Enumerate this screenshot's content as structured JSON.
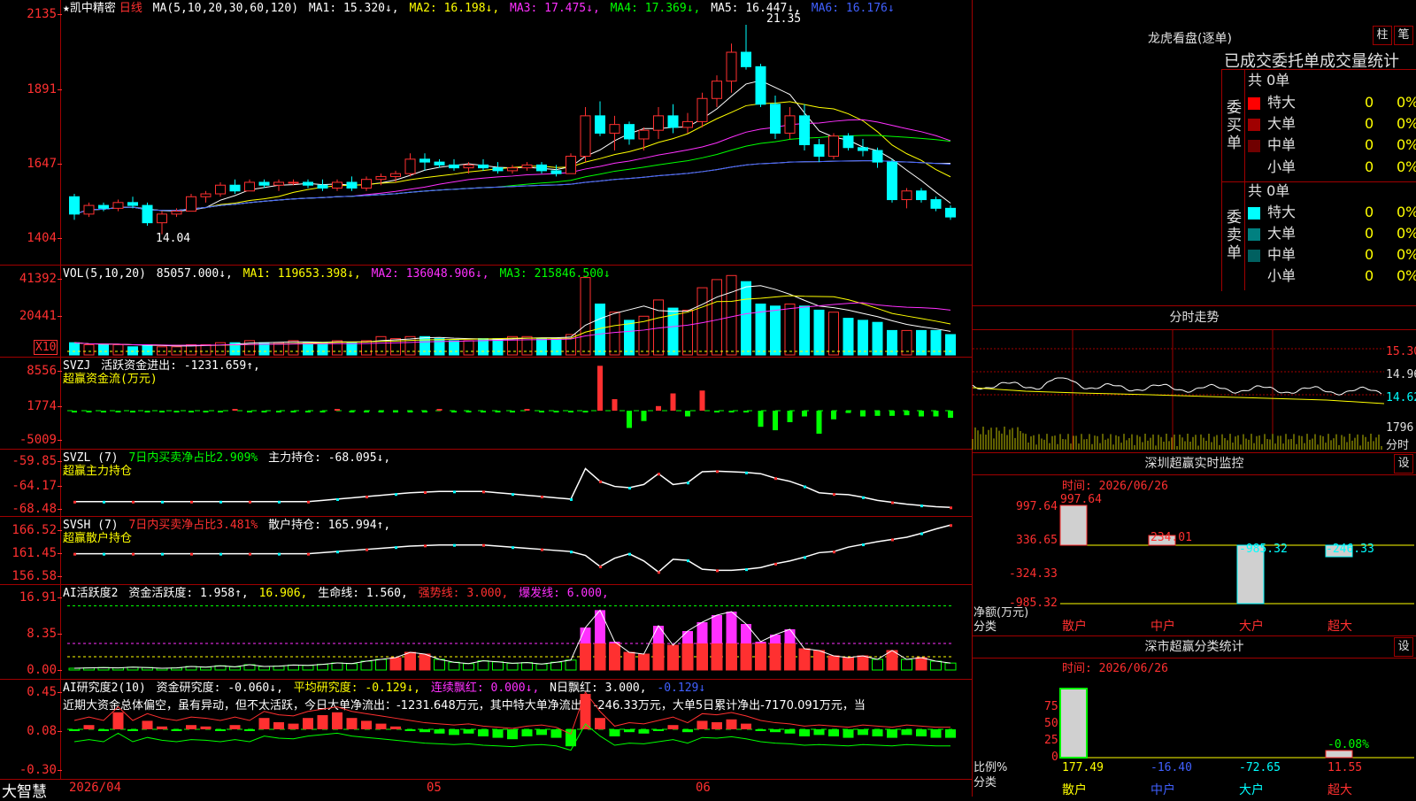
{
  "colors": {
    "up": "#ff3030",
    "down": "#00ffff",
    "bg": "#000000",
    "grid": "#a00000"
  },
  "kline": {
    "title": "★凯中精密",
    "period": "日线",
    "ma_label": "MA(5,10,20,30,60,120)",
    "ma1": "MA1: 15.320↓,",
    "ma2": "MA2: 16.198↓,",
    "ma3": "MA3: 17.475↓,",
    "ma4": "MA4: 17.369↓,",
    "ma5": "MA5: 16.447↓,",
    "ma6": "MA6: 16.176↓",
    "yticks": [
      "2135",
      "1891",
      "1647",
      "1404"
    ],
    "high_label": "21.35",
    "low_label": "14.04"
  },
  "volume": {
    "label": "VOL(5,10,20)",
    "val": "85057.000↓,",
    "ma1": "MA1: 119653.398↓,",
    "ma2": "MA2: 136048.906↓,",
    "ma3": "MA3: 215846.500↓",
    "yticks": [
      "41392",
      "20441"
    ],
    "unit": "X10"
  },
  "svzj": {
    "label": "SVZJ",
    "desc": "活跃资金进出: -1231.659↑,",
    "sub": "超赢资金流(万元)",
    "yticks": [
      "8556",
      "1774",
      "-5009"
    ]
  },
  "svzl": {
    "label": "SVZL (7)",
    "desc1": "7日内买卖净占比2.909%",
    "desc2": "主力持仓: -68.095↓,",
    "sub": "超赢主力持仓",
    "yticks": [
      "-59.85",
      "-64.17",
      "-68.48"
    ]
  },
  "svsh": {
    "label": "SVSH (7)",
    "desc1": "7日内买卖净占比3.481%",
    "desc2": "散户持仓: 165.994↑,",
    "sub": "超赢散户持仓",
    "yticks": [
      "166.52",
      "161.45",
      "156.58"
    ]
  },
  "ai1": {
    "label": "AI活跃度2",
    "d1": "资金活跃度: 1.958↑,",
    "d2": "16.906,",
    "d3": "生命线: 1.560,",
    "d4": "强势线: 3.000,",
    "d5": "爆发线: 6.000,",
    "yticks": [
      "16.91",
      "8.35",
      "0.00"
    ]
  },
  "ai2": {
    "label": "AI研究度2(10)",
    "d1": "资金研究度: -0.060↓,",
    "d2": "平均研究度: -0.129↓,",
    "d3": "连续飘红: 0.000↓,",
    "d4": "N日飘红: 3.000,",
    "d5": "-0.129↓",
    "note": "近期大资金总体偏空，虽有异动，但不太活跃，今日大单净流出：-1231.648万元，其中特大单净流出：-246.33万元，大单5日累计净出-7170.091万元，当",
    "yticks": [
      "0.45",
      "0.08",
      "-0.30"
    ]
  },
  "footer": {
    "brand": "大智慧",
    "d1": "2026/04",
    "d2": "05",
    "d3": "06"
  },
  "dragon": {
    "title": "龙虎看盘(逐单)",
    "btn1": "柱",
    "btn2": "笔",
    "header": "已成交委托单成交量统计",
    "buy_side": "委买单",
    "sell_side": "委卖单",
    "buy_total": "共 0单",
    "sell_total": "共 0单",
    "buy_rows": [
      {
        "name": "特大",
        "v": "0",
        "p": "0%"
      },
      {
        "name": "大单",
        "v": "0",
        "p": "0%"
      },
      {
        "name": "中单",
        "v": "0",
        "p": "0%"
      },
      {
        "name": "小单",
        "v": "0",
        "p": "0%"
      }
    ],
    "sell_rows": [
      {
        "name": "特大",
        "v": "0",
        "p": "0%"
      },
      {
        "name": "大单",
        "v": "0",
        "p": "0%"
      },
      {
        "name": "中单",
        "v": "0",
        "p": "0%"
      },
      {
        "name": "小单",
        "v": "0",
        "p": "0%"
      }
    ]
  },
  "intraday": {
    "title": "分时走势",
    "p1": "15.30",
    "p2": "14.96",
    "p3": "14.62",
    "vol": "1796",
    "unit": "分时"
  },
  "monitor": {
    "title": "深圳超赢实时监控",
    "btn": "设",
    "time": "时间: 2026/06/26",
    "yticks": [
      "997.64",
      "336.65",
      "-324.33",
      "-985.32"
    ],
    "ylabel": "净额(万元)",
    "xlabel": "分类",
    "cats": [
      "散户",
      "中户",
      "大户",
      "超大"
    ],
    "vals": [
      "997.64",
      "234.01",
      "-985.32",
      "-246.33"
    ]
  },
  "classify": {
    "title": "深市超赢分类统计",
    "btn": "设",
    "time": "时间: 2026/06/26",
    "yticks": [
      "75",
      "50",
      "25",
      "0"
    ],
    "ylabel": "比例%",
    "xlabel": "分类",
    "cats": [
      "散户",
      "中户",
      "大户",
      "超大"
    ],
    "vals": [
      "177.49",
      "-16.40",
      "-72.65",
      "11.55"
    ],
    "extra": "-0.08%"
  },
  "chart_data": [
    {
      "type": "candlestick",
      "title": "凯中精密 日线",
      "ohlc": [
        [
          15.4,
          15.5,
          14.6,
          14.8
        ],
        [
          14.8,
          15.2,
          14.7,
          15.1
        ],
        [
          15.1,
          15.2,
          14.9,
          15.0
        ],
        [
          15.0,
          15.3,
          14.9,
          15.2
        ],
        [
          15.2,
          15.4,
          15.0,
          15.1
        ],
        [
          15.1,
          15.2,
          14.4,
          14.5
        ],
        [
          14.5,
          14.9,
          14.1,
          14.8
        ],
        [
          14.8,
          15.0,
          14.7,
          14.9
        ],
        [
          14.9,
          15.5,
          14.9,
          15.4
        ],
        [
          15.4,
          15.6,
          15.2,
          15.5
        ],
        [
          15.5,
          15.9,
          15.4,
          15.8
        ],
        [
          15.8,
          16.0,
          15.5,
          15.6
        ],
        [
          15.6,
          16.0,
          15.6,
          15.9
        ],
        [
          15.9,
          16.0,
          15.7,
          15.8
        ],
        [
          15.8,
          16.0,
          15.6,
          15.9
        ],
        [
          15.9,
          16.0,
          15.8,
          15.9
        ],
        [
          15.9,
          16.0,
          15.7,
          15.8
        ],
        [
          15.8,
          16.0,
          15.6,
          15.7
        ],
        [
          15.7,
          16.0,
          15.6,
          15.9
        ],
        [
          15.9,
          16.1,
          15.6,
          15.7
        ],
        [
          15.7,
          16.1,
          15.6,
          16.0
        ],
        [
          16.0,
          16.2,
          15.8,
          16.1
        ],
        [
          16.1,
          16.3,
          15.9,
          16.2
        ],
        [
          16.2,
          16.9,
          16.1,
          16.7
        ],
        [
          16.7,
          16.9,
          16.3,
          16.6
        ],
        [
          16.6,
          16.7,
          16.4,
          16.5
        ],
        [
          16.5,
          16.7,
          16.3,
          16.4
        ],
        [
          16.4,
          16.6,
          16.2,
          16.5
        ],
        [
          16.5,
          16.7,
          16.3,
          16.4
        ],
        [
          16.4,
          16.6,
          16.2,
          16.3
        ],
        [
          16.3,
          16.5,
          16.2,
          16.4
        ],
        [
          16.4,
          16.6,
          16.3,
          16.5
        ],
        [
          16.5,
          16.6,
          16.2,
          16.3
        ],
        [
          16.3,
          16.5,
          16.1,
          16.2
        ],
        [
          16.2,
          16.9,
          16.2,
          16.8
        ],
        [
          16.8,
          18.5,
          16.6,
          18.2
        ],
        [
          18.2,
          18.7,
          17.5,
          17.6
        ],
        [
          17.6,
          18.2,
          17.0,
          17.9
        ],
        [
          17.9,
          18.0,
          17.2,
          17.4
        ],
        [
          17.4,
          17.8,
          17.0,
          17.7
        ],
        [
          17.7,
          18.5,
          17.4,
          18.2
        ],
        [
          18.2,
          18.6,
          17.6,
          17.8
        ],
        [
          17.8,
          18.3,
          17.6,
          18.0
        ],
        [
          18.0,
          19.0,
          17.8,
          18.8
        ],
        [
          18.8,
          19.6,
          18.5,
          19.4
        ],
        [
          19.4,
          20.7,
          19.0,
          20.4
        ],
        [
          20.4,
          21.35,
          19.8,
          19.9
        ],
        [
          19.9,
          20.0,
          18.5,
          18.6
        ],
        [
          18.6,
          18.9,
          17.4,
          17.6
        ],
        [
          17.6,
          18.5,
          17.4,
          18.2
        ],
        [
          18.2,
          18.6,
          17.0,
          17.2
        ],
        [
          17.2,
          17.4,
          16.6,
          16.8
        ],
        [
          16.8,
          17.6,
          16.7,
          17.5
        ],
        [
          17.5,
          17.6,
          17.0,
          17.1
        ],
        [
          17.1,
          17.4,
          16.8,
          17.0
        ],
        [
          17.0,
          17.1,
          16.4,
          16.6
        ],
        [
          16.6,
          16.7,
          15.2,
          15.3
        ],
        [
          15.3,
          15.7,
          15.0,
          15.6
        ],
        [
          15.6,
          15.7,
          15.2,
          15.3
        ],
        [
          15.3,
          15.4,
          14.9,
          15.0
        ],
        [
          15.0,
          15.1,
          14.6,
          14.7
        ]
      ],
      "ylim": [
        14.0,
        21.35
      ]
    },
    {
      "type": "bar",
      "title": "VOL",
      "values": [
        6,
        5,
        5,
        5,
        4,
        5,
        4,
        4,
        5,
        5,
        6,
        6,
        7,
        6,
        6,
        7,
        6,
        6,
        7,
        6,
        7,
        9,
        8,
        9,
        9,
        8,
        7,
        7,
        8,
        8,
        9,
        9,
        8,
        8,
        10,
        38,
        25,
        21,
        17,
        19,
        27,
        23,
        22,
        33,
        37,
        39,
        36,
        25,
        24,
        25,
        24,
        22,
        21,
        18,
        17,
        16,
        12,
        12,
        12,
        12,
        10
      ]
    },
    {
      "type": "bar",
      "title": "超赢资金流(万元)",
      "values": [
        -60,
        -50,
        -55,
        -60,
        -50,
        -80,
        -60,
        -40,
        -100,
        -60,
        -40,
        50,
        -90,
        -40,
        -40,
        -40,
        -20,
        -40,
        50,
        -60,
        -60,
        -40,
        -30,
        -200,
        -80,
        150,
        -250,
        -40,
        -40,
        -60,
        -70,
        30,
        -40,
        -50,
        -30,
        -60,
        7800,
        2000,
        -3000,
        -1800,
        800,
        3000,
        -1000,
        3500,
        -100,
        -150,
        -200,
        -2800,
        -3400,
        -2000,
        -1000,
        -4000,
        -1500,
        -400,
        -1000,
        -900,
        -900,
        -800,
        -1000,
        -1000,
        -1231
      ]
    },
    {
      "type": "line",
      "title": "主力持仓",
      "values": [
        -67.2,
        -67.2,
        -67.2,
        -67.2,
        -67.2,
        -67.2,
        -67.2,
        -67.2,
        -67.2,
        -67.2,
        -67.2,
        -67.2,
        -67.2,
        -67.2,
        -67.2,
        -67.2,
        -67.2,
        -67.0,
        -66.8,
        -66.6,
        -66.4,
        -66.2,
        -66.0,
        -65.8,
        -65.7,
        -65.6,
        -65.6,
        -65.6,
        -65.6,
        -65.8,
        -66.0,
        -66.2,
        -66.4,
        -66.6,
        -66.8,
        -62.0,
        -64.0,
        -64.8,
        -65.0,
        -64.5,
        -62.8,
        -64.5,
        -64.2,
        -62.5,
        -62.4,
        -62.5,
        -62.6,
        -62.8,
        -63.5,
        -64.0,
        -64.8,
        -65.8,
        -66.0,
        -66.1,
        -66.5,
        -67.0,
        -67.3,
        -67.6,
        -67.8,
        -68.0,
        -68.1
      ]
    },
    {
      "type": "line",
      "title": "散户持仓",
      "values": [
        160.8,
        160.8,
        160.8,
        160.8,
        160.8,
        160.8,
        160.8,
        160.8,
        160.8,
        160.8,
        160.8,
        160.8,
        160.8,
        160.8,
        160.8,
        160.8,
        160.8,
        161.0,
        161.2,
        161.4,
        161.6,
        161.8,
        162.0,
        162.2,
        162.3,
        162.4,
        162.4,
        162.4,
        162.4,
        162.2,
        162.0,
        161.8,
        161.6,
        161.4,
        161.2,
        160.5,
        158.5,
        160.0,
        160.8,
        159.5,
        157.5,
        159.8,
        159.6,
        158.0,
        157.8,
        157.8,
        158.0,
        158.3,
        159.0,
        159.5,
        160.2,
        161.0,
        161.2,
        162.0,
        162.5,
        163.0,
        163.4,
        163.8,
        164.5,
        165.3,
        166.0
      ]
    },
    {
      "type": "bar",
      "title": "资金活跃度",
      "values": [
        0.5,
        0.6,
        0.7,
        0.6,
        0.8,
        0.7,
        0.5,
        0.6,
        1.0,
        0.8,
        1.2,
        0.9,
        1.5,
        1.0,
        1.1,
        1.4,
        1.3,
        1.6,
        2.0,
        1.8,
        2.5,
        3.0,
        3.5,
        5.0,
        4.5,
        3.0,
        2.2,
        1.8,
        2.6,
        2.3,
        1.9,
        2.1,
        1.7,
        2.2,
        2.8,
        12.0,
        16.9,
        8.0,
        5.0,
        4.5,
        12.5,
        7.0,
        11.0,
        13.5,
        15.5,
        16.5,
        13.0,
        8.0,
        10.0,
        11.5,
        6.0,
        5.5,
        4.0,
        3.5,
        4.0,
        3.0,
        5.5,
        3.0,
        3.5,
        2.5,
        1.958
      ]
    },
    {
      "type": "bar",
      "title": "资金研究度",
      "values": [
        0.0,
        0.03,
        0.0,
        0.12,
        0.0,
        0.06,
        0.02,
        0.0,
        0.03,
        0.02,
        0.0,
        0.03,
        0.0,
        0.08,
        0.05,
        0.04,
        0.08,
        0.1,
        0.12,
        0.08,
        0.06,
        0.04,
        0.02,
        0.0,
        -0.02,
        -0.03,
        -0.04,
        -0.03,
        -0.05,
        -0.06,
        -0.07,
        -0.05,
        -0.04,
        -0.06,
        -0.12,
        0.25,
        0.08,
        -0.05,
        -0.02,
        -0.03,
        0.0,
        0.03,
        -0.02,
        0.06,
        0.05,
        0.07,
        0.04,
        0.0,
        -0.02,
        -0.03,
        -0.05,
        -0.04,
        -0.05,
        -0.06,
        -0.04,
        -0.05,
        -0.06,
        -0.04,
        -0.05,
        -0.06,
        -0.06
      ]
    }
  ]
}
